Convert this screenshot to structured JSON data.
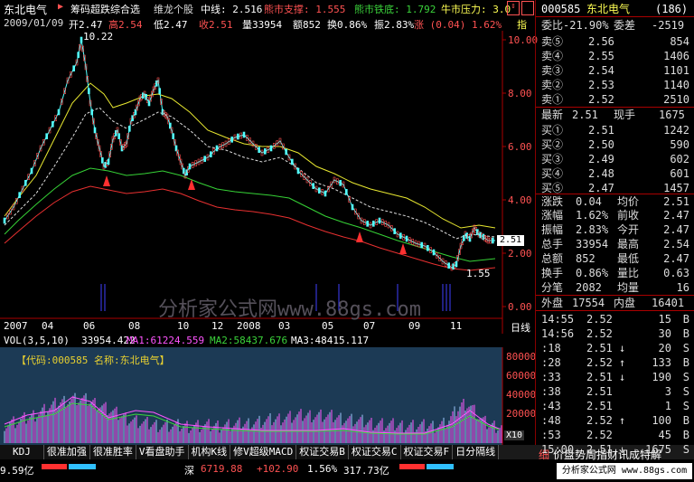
{
  "title": {
    "stock_name": "东北电气",
    "indicator": "筹码超跌综合选",
    "sub": "维龙个股",
    "mid_label": "中线: 2.516",
    "support": "熊市支撑: 1.555",
    "bottom": "熊市铁底: 1.792",
    "pressure": "牛市压力: 3.0"
  },
  "info": {
    "date": "2009/01/09",
    "open": "开2.47",
    "high": "高2.54",
    "low": "低2.47",
    "close": "收2.51",
    "volume": "量33954",
    "amount": "额852",
    "turnover": "换0.86%",
    "amplitude": "振2.83%",
    "change": "涨 (0.04) 1.62%",
    "tail": "指"
  },
  "main_chart": {
    "high_label": "10.22",
    "low_label": "1.55",
    "current_price": "2.51",
    "y_ticks": [
      "10.00",
      "8.00",
      "6.00",
      "4.00",
      "2.00",
      "0.00"
    ],
    "x_ticks": [
      "2007",
      "04",
      "06",
      "08",
      "10",
      "12",
      "2008",
      "03",
      "05",
      "07",
      "09",
      "11"
    ],
    "period": "日线",
    "watermark": "分析家公式网www.88gs.com"
  },
  "volume": {
    "header": "VOL(3,5,10)",
    "v": "33954.422",
    "ma1": "MA1:61224.559",
    "ma2": "MA2:58437.676",
    "ma3": "MA3:48415.117",
    "code_label": "【代码:000585 名称:东北电气】",
    "y_ticks": [
      "80000",
      "60000",
      "40000",
      "20000"
    ],
    "unit": "X10"
  },
  "tabs": [
    "KDJ",
    "很准加强",
    "很准胜率",
    "V看盘助手",
    "机构K线",
    "修V超级MACD",
    "权证交易B",
    "权证交易C",
    "权证交易F",
    "日分隔线"
  ],
  "status": {
    "left": "9.59亿",
    "index_name": "深",
    "index_value": "6719.88",
    "index_change": "+102.90",
    "index_pct": "1.56%",
    "index_amount": "317.73亿",
    "ticker_label": "细",
    "right_text": "价盘势周指财讯成特解",
    "brand": "分析家公式网 www.88gs.com"
  },
  "quote": {
    "code": "000585",
    "name": "东北电气",
    "number": "(186)",
    "weibi_label": "委比",
    "weibi": "-21.90%",
    "weicha_label": "委差",
    "weicha": "-2519",
    "asks": [
      {
        "label": "卖⑤",
        "price": "2.56",
        "vol": "854"
      },
      {
        "label": "卖④",
        "price": "2.55",
        "vol": "1406"
      },
      {
        "label": "卖③",
        "price": "2.54",
        "vol": "1101"
      },
      {
        "label": "卖②",
        "price": "2.53",
        "vol": "1140"
      },
      {
        "label": "卖①",
        "price": "2.52",
        "vol": "2510"
      }
    ],
    "last_label": "最新",
    "last": "2.51",
    "hand_label": "现手",
    "hand": "1675",
    "bids": [
      {
        "label": "买①",
        "price": "2.51",
        "vol": "1242"
      },
      {
        "label": "买②",
        "price": "2.50",
        "vol": "590"
      },
      {
        "label": "买③",
        "price": "2.49",
        "vol": "602"
      },
      {
        "label": "买④",
        "price": "2.48",
        "vol": "601"
      },
      {
        "label": "买⑤",
        "price": "2.47",
        "vol": "1457"
      }
    ],
    "stats": [
      {
        "l1": "涨跌",
        "v1": "0.04",
        "c1": "red",
        "l2": "均价",
        "v2": "2.51",
        "c2": "red"
      },
      {
        "l1": "涨幅",
        "v1": "1.62%",
        "c1": "red",
        "l2": "前收",
        "v2": "2.47",
        "c2": "white"
      },
      {
        "l1": "振幅",
        "v1": "2.83%",
        "c1": "white",
        "l2": "今开",
        "v2": "2.47",
        "c2": "white"
      },
      {
        "l1": "总手",
        "v1": "33954",
        "c1": "white",
        "l2": "最高",
        "v2": "2.54",
        "c2": "red"
      },
      {
        "l1": "总额",
        "v1": "852",
        "c1": "white",
        "l2": "最低",
        "v2": "2.47",
        "c2": "white"
      },
      {
        "l1": "换手",
        "v1": "0.86%",
        "c1": "white",
        "l2": "量比",
        "v2": "0.63",
        "c2": "white"
      },
      {
        "l1": "分笔",
        "v1": "2082",
        "c1": "white",
        "l2": "均量",
        "v2": "16",
        "c2": "white"
      }
    ],
    "outer_label": "外盘",
    "outer": "17554",
    "inner_label": "内盘",
    "inner": "16401",
    "ticks": [
      {
        "time": "14:55",
        "price": "2.52",
        "arrow": "",
        "vol": "15",
        "side": "B"
      },
      {
        "time": "14:56",
        "price": "2.52",
        "arrow": "",
        "vol": "30",
        "side": "B"
      },
      {
        "time": ":18",
        "price": "2.51",
        "arrow": "↓",
        "vol": "20",
        "side": "S"
      },
      {
        "time": ":28",
        "price": "2.52",
        "arrow": "↑",
        "vol": "133",
        "side": "B"
      },
      {
        "time": ":33",
        "price": "2.51",
        "arrow": "↓",
        "vol": "190",
        "side": "S"
      },
      {
        "time": ":38",
        "price": "2.51",
        "arrow": "",
        "vol": "3",
        "side": "S"
      },
      {
        "time": ":43",
        "price": "2.51",
        "arrow": "",
        "vol": "1",
        "side": "S"
      },
      {
        "time": ":48",
        "price": "2.52",
        "arrow": "↑",
        "vol": "100",
        "side": "B"
      },
      {
        "time": ":53",
        "price": "2.52",
        "arrow": "",
        "vol": "45",
        "side": "B"
      },
      {
        "time": "15:00",
        "price": "2.51",
        "arrow": "↓",
        "vol": "1675",
        "side": "S"
      }
    ]
  }
}
